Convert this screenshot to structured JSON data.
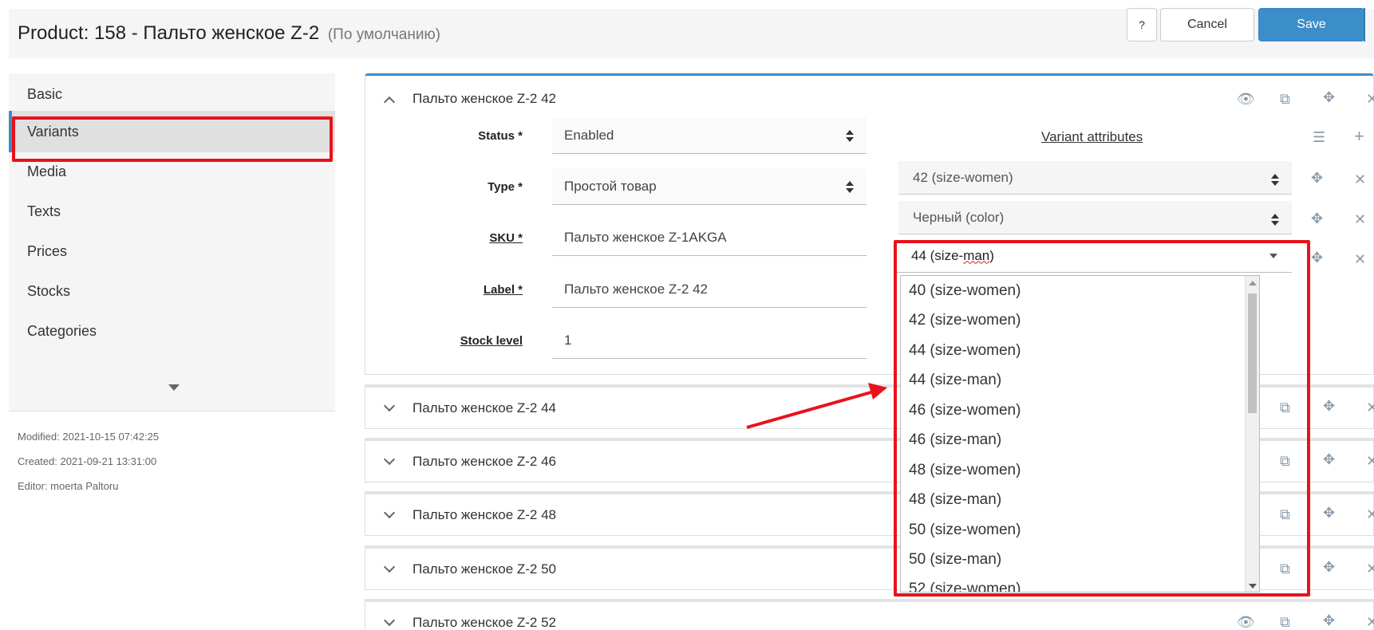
{
  "header": {
    "title": "Product: 158 - Пальто женское Z-2",
    "subtitle": "(По умолчанию)",
    "help_label": "?",
    "cancel_label": "Cancel",
    "save_label": "Save"
  },
  "sidebar": {
    "items": [
      {
        "label": "Basic"
      },
      {
        "label": "Variants",
        "active": true
      },
      {
        "label": "Media"
      },
      {
        "label": "Texts"
      },
      {
        "label": "Prices"
      },
      {
        "label": "Stocks"
      },
      {
        "label": "Categories"
      }
    ],
    "modified": "Modified: 2021-10-15 07:42:25",
    "created": "Created: 2021-09-21 13:31:00",
    "editor": "Editor: moerta Paltoru"
  },
  "variant_open": {
    "title": "Пальто женское Z-2 42",
    "fields": {
      "status_label": "Status *",
      "status_value": "Enabled",
      "type_label": "Type *",
      "type_value": "Простой товар",
      "sku_label": "SKU *",
      "sku_value": "Пальто женское Z-1AKGA",
      "label_label": "Label *",
      "label_value": "Пальто женское Z-2 42",
      "stock_label": "Stock level",
      "stock_value": "1"
    },
    "attributes_title": "Variant attributes",
    "attributes": [
      "42 (size-women)",
      "Черный (color)"
    ],
    "attribute_input": {
      "prefix": "44 (size-",
      "typed": "man",
      "suffix": ")"
    },
    "dropdown_options": [
      "40 (size-women)",
      "42 (size-women)",
      "44 (size-women)",
      "44 (size-man)",
      "46 (size-women)",
      "46 (size-man)",
      "48 (size-women)",
      "48 (size-man)",
      "50 (size-women)",
      "50 (size-man)",
      "52 (size-women)"
    ]
  },
  "variants_collapsed": [
    {
      "title": "Пальто женское Z-2 44"
    },
    {
      "title": "Пальто женское Z-2 46"
    },
    {
      "title": "Пальто женское Z-2 48"
    },
    {
      "title": "Пальто женское Z-2 50"
    },
    {
      "title": "Пальто женское Z-2 52"
    }
  ],
  "icons": {
    "eye": "eye-icon",
    "copy": "copy-icon",
    "move": "move-icon",
    "remove": "close-icon",
    "list": "list-icon",
    "add": "plus-icon"
  },
  "colors": {
    "accent": "#3b8ec9",
    "annotation": "#e8121b"
  }
}
